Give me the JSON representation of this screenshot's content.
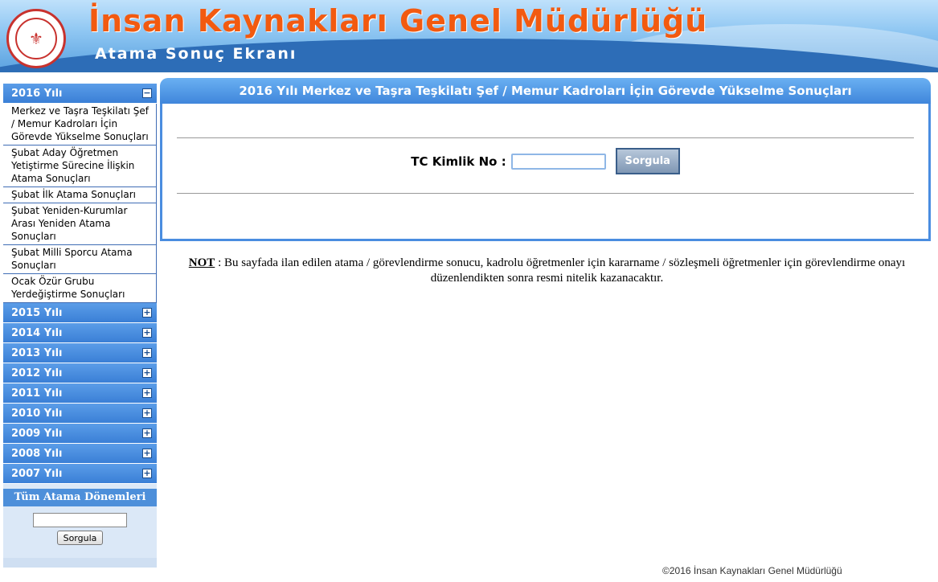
{
  "header": {
    "title": "İnsan Kaynakları Genel Müdürlüğü",
    "subtitle": "Atama Sonuç Ekranı",
    "logo_symbol": "⚜"
  },
  "sidebar": {
    "expanded_year": {
      "label": "2016 Yılı",
      "toggle": "−",
      "items": [
        "Merkez ve Taşra Teşkilatı Şef / Memur Kadroları İçin Görevde Yükselme Sonuçları",
        "Şubat Aday Öğretmen Yetiştirme Sürecine İlişkin Atama Sonuçları",
        "Şubat İlk Atama Sonuçları",
        "Şubat Yeniden-Kurumlar Arası Yeniden Atama Sonuçları",
        "Şubat Milli Sporcu Atama Sonuçları",
        "Ocak Özür Grubu Yerdeğiştirme Sonuçları"
      ]
    },
    "collapsed_years": [
      {
        "label": "2015 Yılı",
        "toggle": "+"
      },
      {
        "label": "2014 Yılı",
        "toggle": "+"
      },
      {
        "label": "2013 Yılı",
        "toggle": "+"
      },
      {
        "label": "2012 Yılı",
        "toggle": "+"
      },
      {
        "label": "2011 Yılı",
        "toggle": "+"
      },
      {
        "label": "2010 Yılı",
        "toggle": "+"
      },
      {
        "label": "2009 Yılı",
        "toggle": "+"
      },
      {
        "label": "2008 Yılı",
        "toggle": "+"
      },
      {
        "label": "2007 Yılı",
        "toggle": "+"
      }
    ],
    "all_periods_label": "Tüm Atama Dönemleri",
    "search_value": "",
    "search_button": "Sorgula"
  },
  "main": {
    "panel_title": "2016 Yılı Merkez ve Taşra Teşkilatı Şef / Memur Kadroları İçin Görevde Yükselme Sonuçları",
    "tc_label": "TC Kimlik No :",
    "tc_value": "",
    "query_button": "Sorgula",
    "note_label": "NOT",
    "note_text": " : Bu sayfada ilan edilen atama / görevlendirme sonucu, kadrolu öğretmenler için kararname / sözleşmeli öğretmenler için görevlendirme onayı düzenlendikten sonra resmi nitelik kazanacaktır."
  },
  "footer": {
    "copyright": "©2016 İnsan Kaynakları Genel Müdürlüğü"
  },
  "colors": {
    "title_orange": "#f25a10",
    "menu_blue": "#3a7fd6",
    "panel_blue": "#4a8de0"
  }
}
